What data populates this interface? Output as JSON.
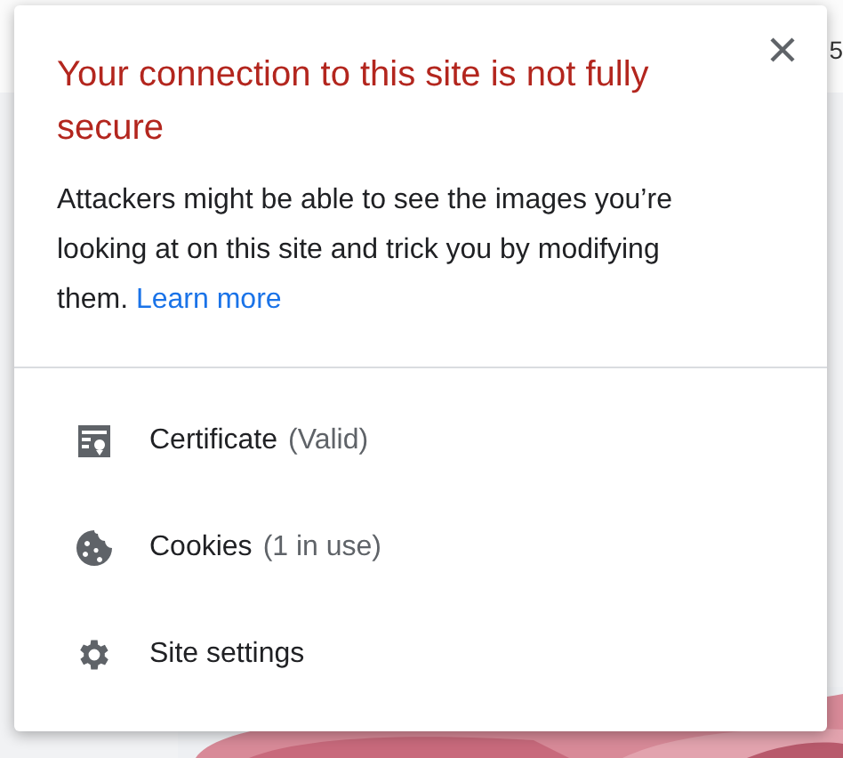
{
  "background": {
    "edge_text": "5",
    "kind": "picture"
  },
  "popup": {
    "title": "Your connection to this site is not fully secure",
    "message": "Attackers might be able to see the images you’re looking at on this site and trick you by modifying them.",
    "link": "Learn more",
    "items": [
      {
        "kind": "certificate",
        "label": "Certificate",
        "detail": "(Valid)"
      },
      {
        "kind": "cookies",
        "label": "Cookies",
        "detail": "(1 in use)"
      },
      {
        "kind": "settings",
        "label": "Site settings"
      }
    ]
  }
}
